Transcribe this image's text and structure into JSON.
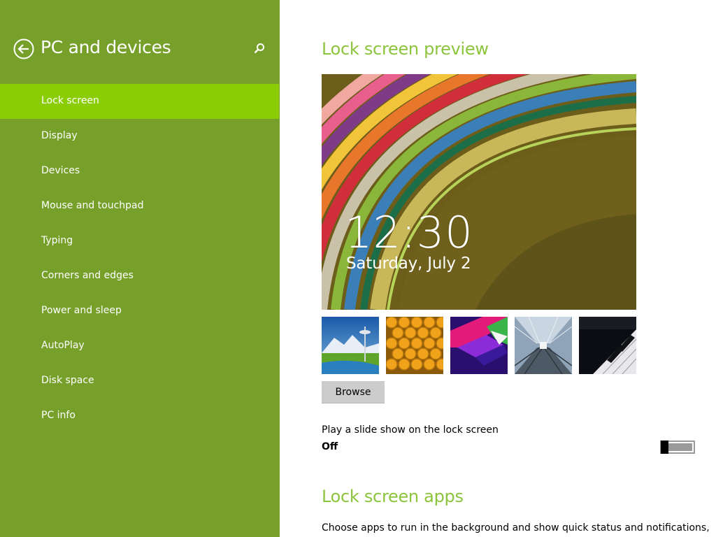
{
  "sidebar": {
    "title": "PC and devices",
    "background": "#76a02a",
    "selected_background": "#8bcd05",
    "back_icon": "back-arrow-circle-icon",
    "search_icon": "search-icon",
    "items": [
      {
        "label": "Lock screen",
        "selected": true
      },
      {
        "label": "Display",
        "selected": false
      },
      {
        "label": "Devices",
        "selected": false
      },
      {
        "label": "Mouse and touchpad",
        "selected": false
      },
      {
        "label": "Typing",
        "selected": false
      },
      {
        "label": "Corners and edges",
        "selected": false
      },
      {
        "label": "Power and sleep",
        "selected": false
      },
      {
        "label": "AutoPlay",
        "selected": false
      },
      {
        "label": "Disk space",
        "selected": false
      },
      {
        "label": "PC info",
        "selected": false
      }
    ]
  },
  "main": {
    "accent_color": "#8cc43c",
    "preview_heading": "Lock screen preview",
    "preview": {
      "time": "12:30",
      "date": "Saturday, July 2"
    },
    "thumbnails": [
      {
        "name": "space-needle-thumbnail"
      },
      {
        "name": "honeycomb-thumbnail"
      },
      {
        "name": "abstract-shapes-thumbnail"
      },
      {
        "name": "train-tunnel-thumbnail"
      },
      {
        "name": "piano-keys-thumbnail"
      }
    ],
    "browse_label": "Browse",
    "slideshow": {
      "label": "Play a slide show on the lock screen",
      "state": "Off",
      "on": false
    },
    "apps_heading": "Lock screen apps",
    "apps_description": "Choose apps to run in the background and show quick status and notifications,"
  }
}
